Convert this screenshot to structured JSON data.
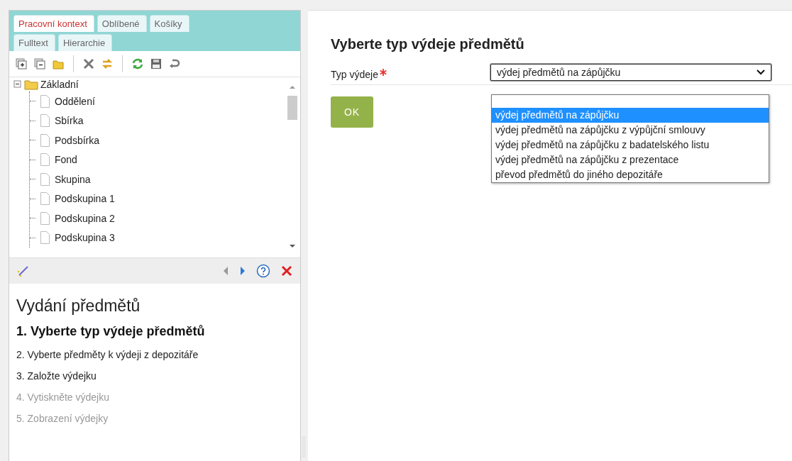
{
  "sidebar": {
    "tab_rows": [
      [
        {
          "label": "Pracovní kontext",
          "selected": true
        },
        {
          "label": "Oblíbené",
          "selected": false
        },
        {
          "label": "Košíky",
          "selected": false
        }
      ],
      [
        {
          "label": "Fulltext",
          "selected": false
        },
        {
          "label": "Hierarchie",
          "selected": false
        }
      ]
    ],
    "tree": {
      "label": "Základní",
      "expanded": true,
      "children": [
        {
          "label": "Oddělení"
        },
        {
          "label": "Sbírka"
        },
        {
          "label": "Podsbírka"
        },
        {
          "label": "Fond"
        },
        {
          "label": "Skupina"
        },
        {
          "label": "Podskupina 1"
        },
        {
          "label": "Podskupina 2"
        },
        {
          "label": "Podskupina 3"
        }
      ]
    },
    "wizard": {
      "title": "Vydání předmětů",
      "steps": [
        {
          "label": "1. Vyberte typ výdeje předmětů",
          "selected": true,
          "disabled": false
        },
        {
          "label": "2. Vyberte předměty k výdeji z depozitáře",
          "selected": false,
          "disabled": false
        },
        {
          "label": "3. Založte výdejku",
          "selected": false,
          "disabled": false
        },
        {
          "label": "4. Vytiskněte výdejku",
          "selected": false,
          "disabled": true
        },
        {
          "label": "5. Zobrazení výdejky",
          "selected": false,
          "disabled": true
        }
      ]
    }
  },
  "main": {
    "title": "Vyberte typ výdeje předmětů",
    "field": {
      "label": "Typ výdeje",
      "required": true,
      "value": "výdej předmětů na zápůjčku",
      "expanded": true,
      "options": [
        {
          "label": "výdej předmětů na zápůjčku",
          "selected": true
        },
        {
          "label": "výdej předmětů na zápůjčku z výpůjční smlouvy",
          "selected": false
        },
        {
          "label": "výdej předmětů na zápůjčku z badatelského listu",
          "selected": false
        },
        {
          "label": "výdej předmětů na zápůjčku z prezentace",
          "selected": false
        },
        {
          "label": "převod předmětů do jiného depozitáře",
          "selected": false
        }
      ]
    },
    "ok_button": "OK"
  }
}
